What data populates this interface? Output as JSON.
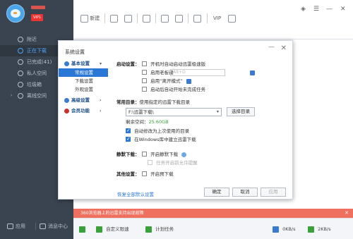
{
  "user": {
    "vip_label": "VIP1"
  },
  "sidebar": {
    "items": [
      {
        "label": "附近",
        "icon": "location-icon"
      },
      {
        "label": "正在下载",
        "icon": "download-icon"
      },
      {
        "label": "已完成(41)",
        "icon": "check-circle-icon"
      },
      {
        "label": "私人空间",
        "icon": "lock-icon"
      },
      {
        "label": "垃圾箱",
        "icon": "trash-icon"
      },
      {
        "label": "离线空间",
        "icon": "cloud-icon"
      }
    ],
    "footer": {
      "apps_label": "应用",
      "messages_label": "消息中心"
    }
  },
  "toolbar": {
    "new_label": "新建",
    "vip_label": "VIP"
  },
  "notice": {
    "text": "360浏览器上的迅雷支持出现故障"
  },
  "statusbar": {
    "speed_mode_label": "自定义限速",
    "schedule_label": "计划任务",
    "down_speed": "0KB/s",
    "up_speed": "2KB/s"
  },
  "dialog": {
    "title": "系统设置",
    "nav": {
      "basic_group": "基本设置",
      "basic_items": [
        "常规设置",
        "下载设置",
        "外观设置"
      ],
      "advanced_group": "高级设置",
      "vip_group": "会员功能"
    },
    "startup": {
      "label": "启动设置：",
      "options": [
        {
          "label": "开机时自动启动迅雷极速版",
          "checked": false
        },
        {
          "label": "启用老板键",
          "checked": false
        },
        {
          "label": "启用“离开模式”",
          "checked": false
        },
        {
          "label": "启动后自动开始未完成任务",
          "checked": false
        }
      ],
      "hotkey_value": "Alt+D"
    },
    "directory": {
      "label": "常用目录：",
      "hint": "使用指定的迅雷下载目录",
      "path": "F:\\迅雷下载\\",
      "choose_button": "选择目录",
      "free_space_label": "剩余空间：",
      "free_space_value": "25.60GB",
      "auto_modify": {
        "label": "自动修改为上次使用的目录",
        "checked": true
      },
      "create_task_dir": {
        "label": "在Windows库中建立迅雷下载",
        "checked": true
      }
    },
    "silent": {
      "label": "静默下载：",
      "option": {
        "label": "开启静默下载",
        "checked": false
      },
      "sub_option": {
        "label": "任务开启前允许提醒",
        "checked": false
      }
    },
    "other": {
      "label": "其他设置：",
      "option": {
        "label": "开启预下载",
        "checked": false
      }
    },
    "restore_link": "恢复全部默认设置",
    "ok_button": "确定",
    "cancel_button": "取消",
    "apply_button": "应用"
  },
  "colors": {
    "sidebar_bg": "#3a4350",
    "accent": "#2a77d6",
    "notice_bg": "#f07060"
  }
}
